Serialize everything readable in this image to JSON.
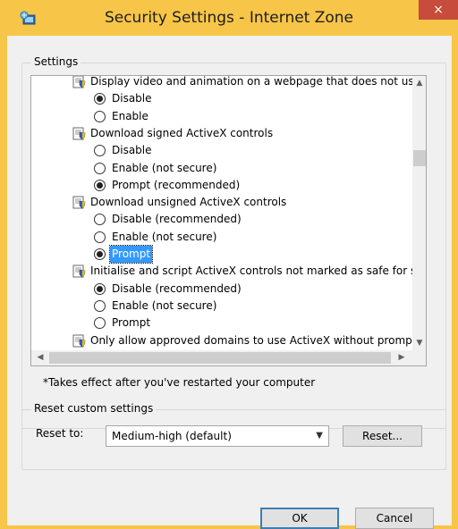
{
  "window": {
    "title": "Security Settings - Internet Zone",
    "close_label": "×"
  },
  "settings": {
    "group_label": "Settings",
    "items": [
      {
        "type": "category",
        "label": "Display video and animation on a webpage that does not use"
      },
      {
        "type": "option",
        "label": "Disable",
        "selected": true
      },
      {
        "type": "option",
        "label": "Enable",
        "selected": false
      },
      {
        "type": "category",
        "label": "Download signed ActiveX controls"
      },
      {
        "type": "option",
        "label": "Disable",
        "selected": false
      },
      {
        "type": "option",
        "label": "Enable (not secure)",
        "selected": false
      },
      {
        "type": "option",
        "label": "Prompt (recommended)",
        "selected": true
      },
      {
        "type": "category",
        "label": "Download unsigned ActiveX controls"
      },
      {
        "type": "option",
        "label": "Disable (recommended)",
        "selected": false
      },
      {
        "type": "option",
        "label": "Enable (not secure)",
        "selected": false
      },
      {
        "type": "option",
        "label": "Prompt",
        "selected": true,
        "highlighted": true
      },
      {
        "type": "category",
        "label": "Initialise and script ActiveX controls not marked as safe for s"
      },
      {
        "type": "option",
        "label": "Disable (recommended)",
        "selected": true
      },
      {
        "type": "option",
        "label": "Enable (not secure)",
        "selected": false
      },
      {
        "type": "option",
        "label": "Prompt",
        "selected": false
      },
      {
        "type": "category",
        "label": "Only allow approved domains to use ActiveX without prompt"
      }
    ],
    "note": "*Takes effect after you've restarted your computer"
  },
  "reset": {
    "group_label": "Reset custom settings",
    "reset_to_label": "Reset to:",
    "selected_value": "Medium-high (default)",
    "reset_button": "Reset..."
  },
  "footer": {
    "ok_label": "OK",
    "cancel_label": "Cancel"
  },
  "colors": {
    "title_bar": "#f7c548",
    "close_button": "#c74c3c",
    "selection": "#3399ff"
  }
}
